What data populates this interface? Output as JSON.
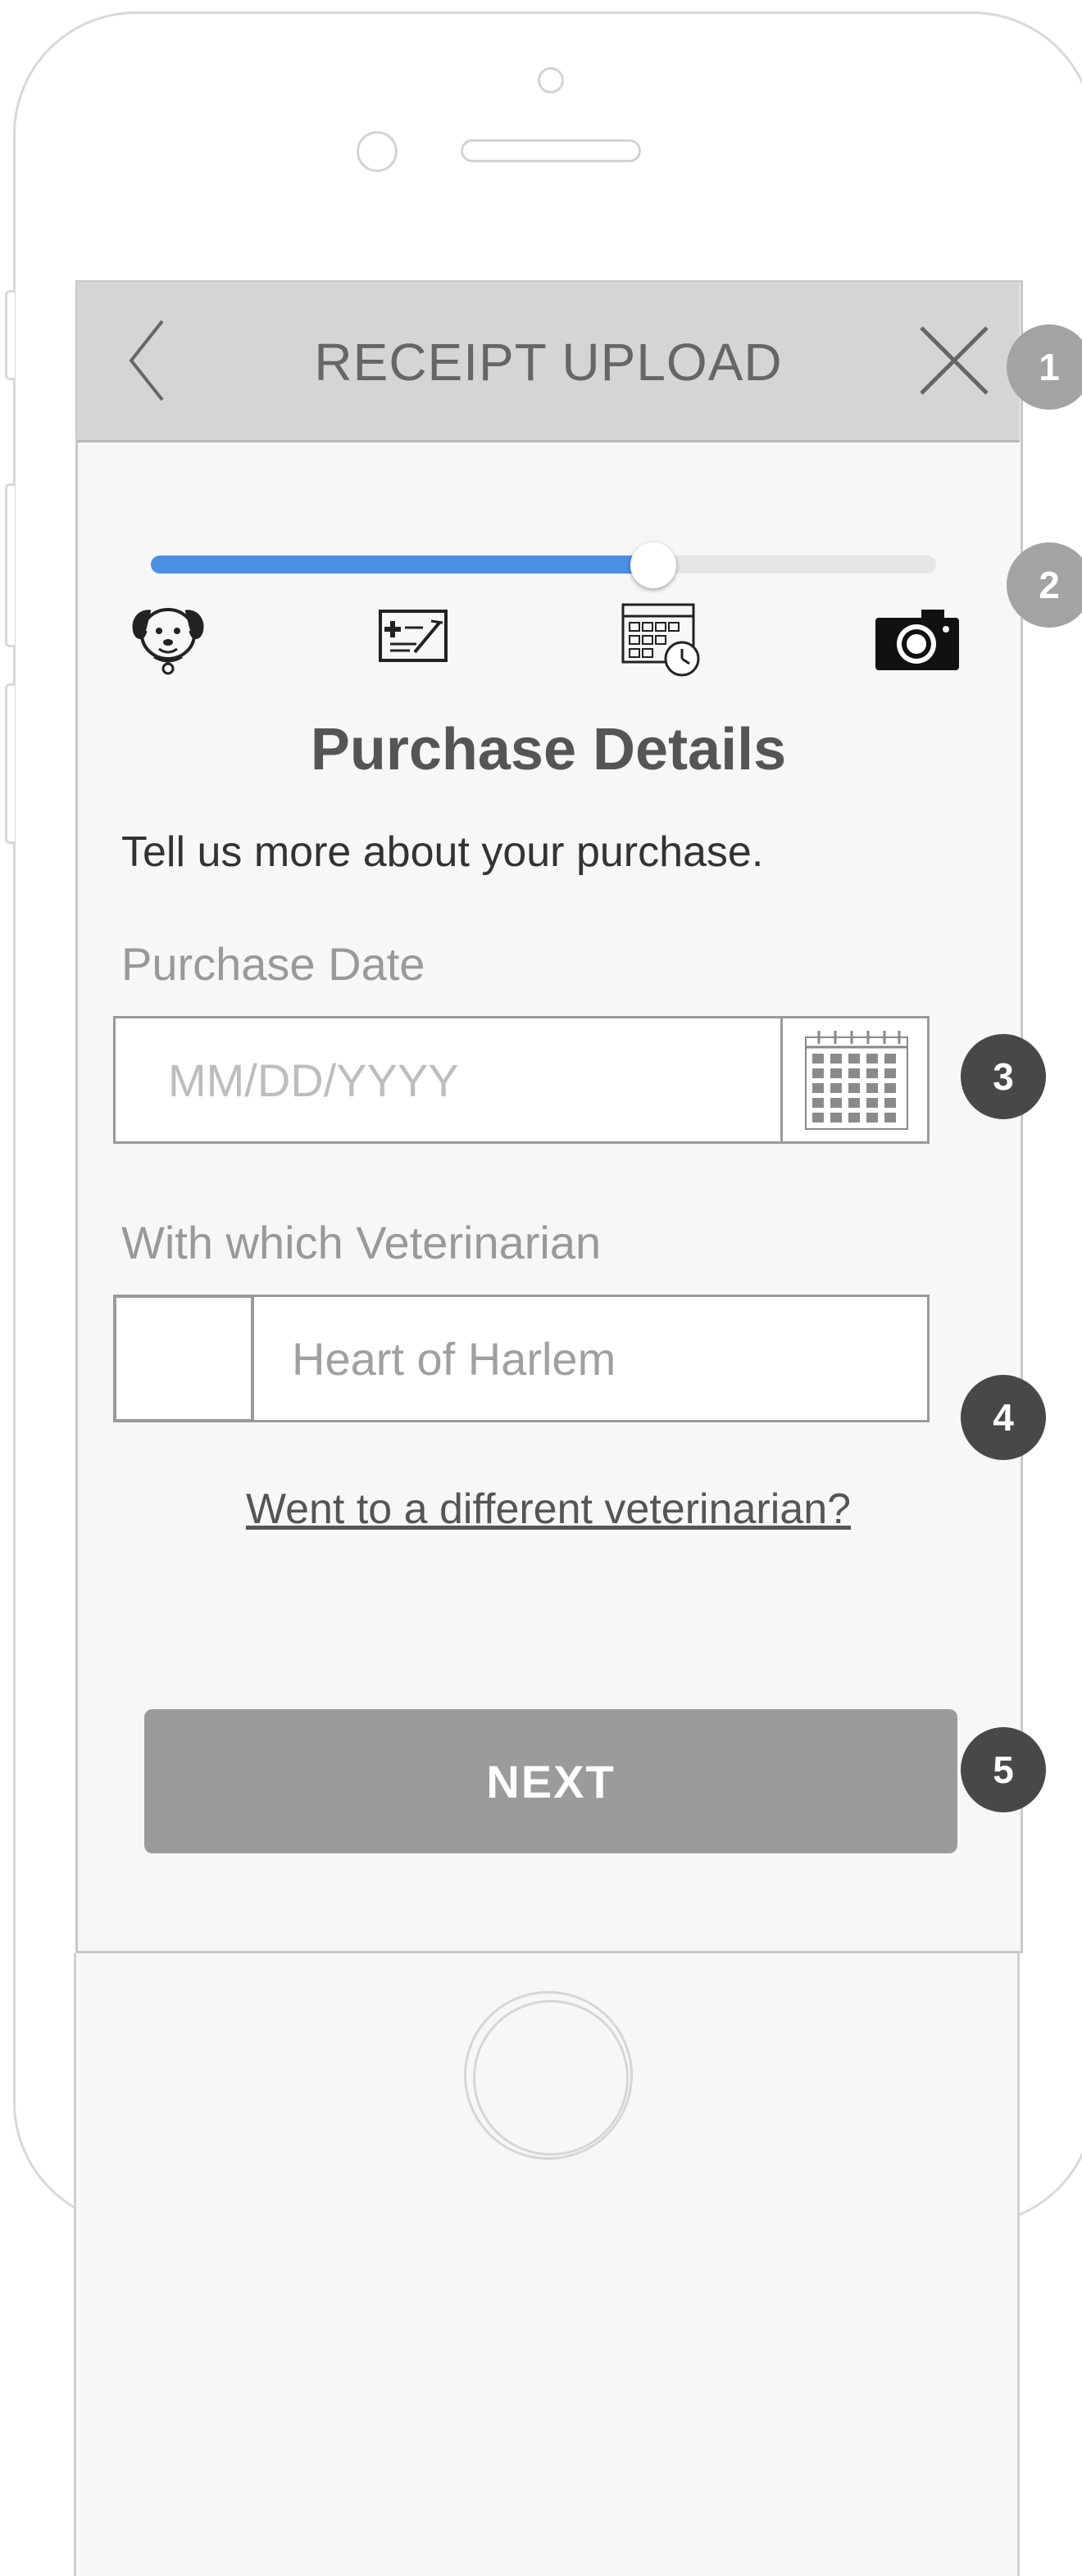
{
  "header": {
    "title": "RECEIPT UPLOAD",
    "back_icon": "chevron-left-icon",
    "close_icon": "close-icon"
  },
  "annotations": [
    "1",
    "2",
    "3",
    "4",
    "5"
  ],
  "progress": {
    "value": 0.64,
    "steps": [
      {
        "icon": "pet-icon"
      },
      {
        "icon": "medical-form-icon"
      },
      {
        "icon": "calendar-clock-icon"
      },
      {
        "icon": "camera-icon"
      }
    ],
    "fill_color": "#4a90e2"
  },
  "content": {
    "title": "Purchase Details",
    "instruction": "Tell us more about your purchase."
  },
  "purchase_date": {
    "label": "Purchase Date",
    "placeholder": "MM/DD/YYYY",
    "calendar_icon": "calendar-icon"
  },
  "veterinarian": {
    "label": "With which Veterinarian",
    "placeholder": "Heart of Harlem",
    "checked": false
  },
  "links": {
    "different_vet": "Went to a different veterinarian?"
  },
  "actions": {
    "next_label": "NEXT"
  }
}
